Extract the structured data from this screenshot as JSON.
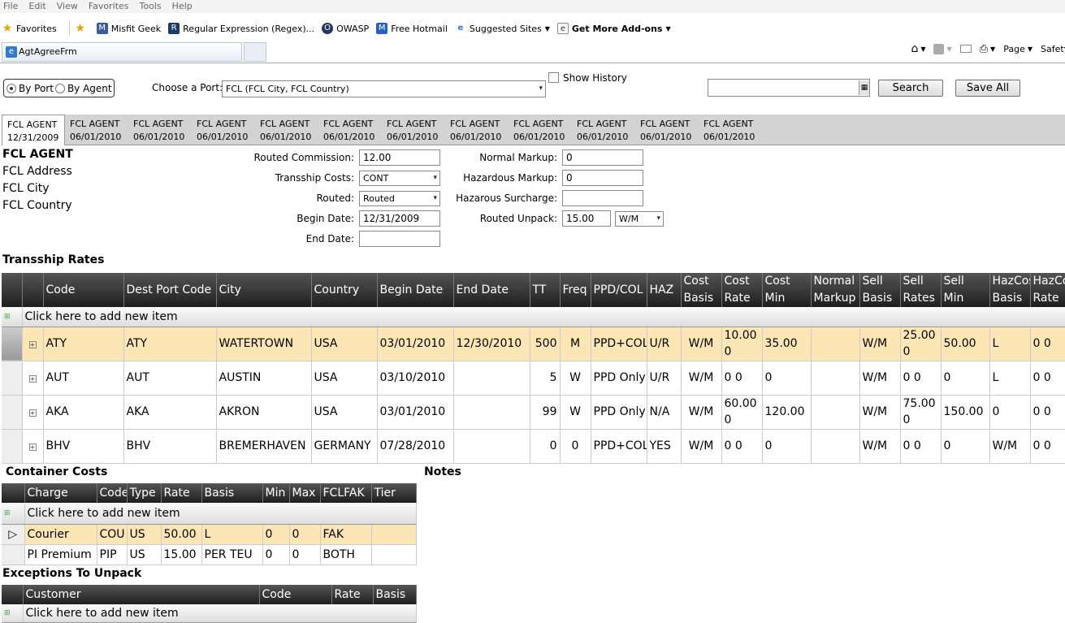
{
  "browser": {
    "menu": [
      "File",
      "Edit",
      "View",
      "Favorites",
      "Tools",
      "Help"
    ],
    "favorites_label": "Favorites",
    "favorites": [
      "Misfit Geek",
      "Regular Expression (Regex)...",
      "OWASP",
      "Free Hotmail",
      "Suggested Sites",
      "Get More Add-ons"
    ],
    "tab_title": "AgtAgreeFrm",
    "commands": [
      "Page",
      "Safety"
    ]
  },
  "controls": {
    "by_port": "By Port",
    "by_agent": "By Agent",
    "choose_port_label": "Choose a Port:",
    "port_value": "FCL (FCL City, FCL Country)",
    "show_history": "Show History",
    "search_label": "Search",
    "save_all_label": "Save All"
  },
  "agent_tabs": [
    {
      "name": "FCL AGENT",
      "date": "12/31/2009"
    },
    {
      "name": "FCL AGENT",
      "date": "06/01/2010"
    },
    {
      "name": "FCL AGENT",
      "date": "06/01/2010"
    },
    {
      "name": "FCL AGENT",
      "date": "06/01/2010"
    },
    {
      "name": "FCL AGENT",
      "date": "06/01/2010"
    },
    {
      "name": "FCL AGENT",
      "date": "06/01/2010"
    },
    {
      "name": "FCL AGENT",
      "date": "06/01/2010"
    },
    {
      "name": "FCL AGENT",
      "date": "06/01/2010"
    },
    {
      "name": "FCL AGENT",
      "date": "06/01/2010"
    },
    {
      "name": "FCL AGENT",
      "date": "06/01/2010"
    },
    {
      "name": "FCL AGENT",
      "date": "06/01/2010"
    },
    {
      "name": "FCL AGENT",
      "date": "06/01/2010"
    }
  ],
  "agent": {
    "name": "FCL AGENT",
    "address": "FCL Address",
    "city": "FCL City",
    "country": "FCL Country"
  },
  "form": {
    "routed_commission_label": "Routed Commission:",
    "routed_commission": "12.00",
    "tranship_costs_label": "Transship Costs:",
    "tranship_costs": "CONT",
    "routed_label": "Routed:",
    "routed": "Routed",
    "begin_date_label": "Begin Date:",
    "begin_date": "12/31/2009",
    "end_date_label": "End Date:",
    "end_date": "",
    "normal_markup_label": "Normal Markup:",
    "normal_markup": "0",
    "haz_markup_label": "Hazardous Markup:",
    "haz_markup": "0",
    "haz_surcharge_label": "Hazarous Surcharge:",
    "haz_surcharge": "",
    "routed_unpack_label": "Routed Unpack:",
    "routed_unpack": "15.00",
    "routed_unpack_basis": "W/M"
  },
  "transship": {
    "title": "Transship Rates",
    "add_item": "Click here to add new item",
    "headers": [
      "Code",
      "Dest Port Code",
      "City",
      "Country",
      "Begin Date",
      "End Date",
      "TT",
      "Freq",
      "PPD/COL",
      "HAZ",
      "Cost Basis",
      "Cost Rate",
      "Cost Min",
      "Normal Markup",
      "Sell Basis",
      "Sell Rates",
      "Sell Min",
      "HazCost Basis",
      "HazCost Rate"
    ],
    "rows": [
      [
        "ATY",
        "ATY",
        "WATERTOWN",
        "USA",
        "03/01/2010",
        "12/30/2010",
        "500",
        "M",
        "PPD+COL",
        "U/R",
        "W/M",
        "10.00 0",
        "35.00",
        "",
        "W/M",
        "25.00 0",
        "50.00",
        "L",
        "0 0"
      ],
      [
        "AUT",
        "AUT",
        "AUSTIN",
        "USA",
        "03/10/2010",
        "",
        "5",
        "W",
        "PPD Only",
        "U/R",
        "W/M",
        "0 0",
        "0",
        "",
        "W/M",
        "0 0",
        "0",
        "L",
        "0 0"
      ],
      [
        "AKA",
        "AKA",
        "AKRON",
        "USA",
        "03/01/2010",
        "",
        "99",
        "W",
        "PPD Only",
        "N/A",
        "W/M",
        "60.00 0",
        "120.00",
        "",
        "W/M",
        "75.00 0",
        "150.00",
        "0",
        "0 0"
      ],
      [
        "BHV",
        "BHV",
        "BREMERHAVEN",
        "GERMANY",
        "07/28/2010",
        "",
        "0",
        "0",
        "PPD+COL",
        "YES",
        "W/M",
        "0 0",
        "0",
        "",
        "W/M",
        "0 0",
        "0",
        "W/M",
        "0 0"
      ]
    ]
  },
  "container": {
    "title": "Container Costs",
    "add_item": "Click here to add new item",
    "headers": [
      "Charge",
      "Code",
      "Type",
      "Rate",
      "Basis",
      "Min",
      "Max",
      "FCLFAK",
      "Tier"
    ],
    "rows": [
      [
        "Courier",
        "COU",
        "US",
        "50.00",
        "L",
        "0",
        "0",
        "FAK",
        ""
      ],
      [
        "PI Premium",
        "PIP",
        "US",
        "15.00",
        "PER TEU",
        "0",
        "0",
        "BOTH",
        ""
      ]
    ]
  },
  "notes": {
    "title": "Notes"
  },
  "exceptions": {
    "title": "Exceptions To Unpack",
    "headers": [
      "Customer",
      "Code",
      "Rate",
      "Basis"
    ],
    "add_item": "Click here to add new item"
  }
}
